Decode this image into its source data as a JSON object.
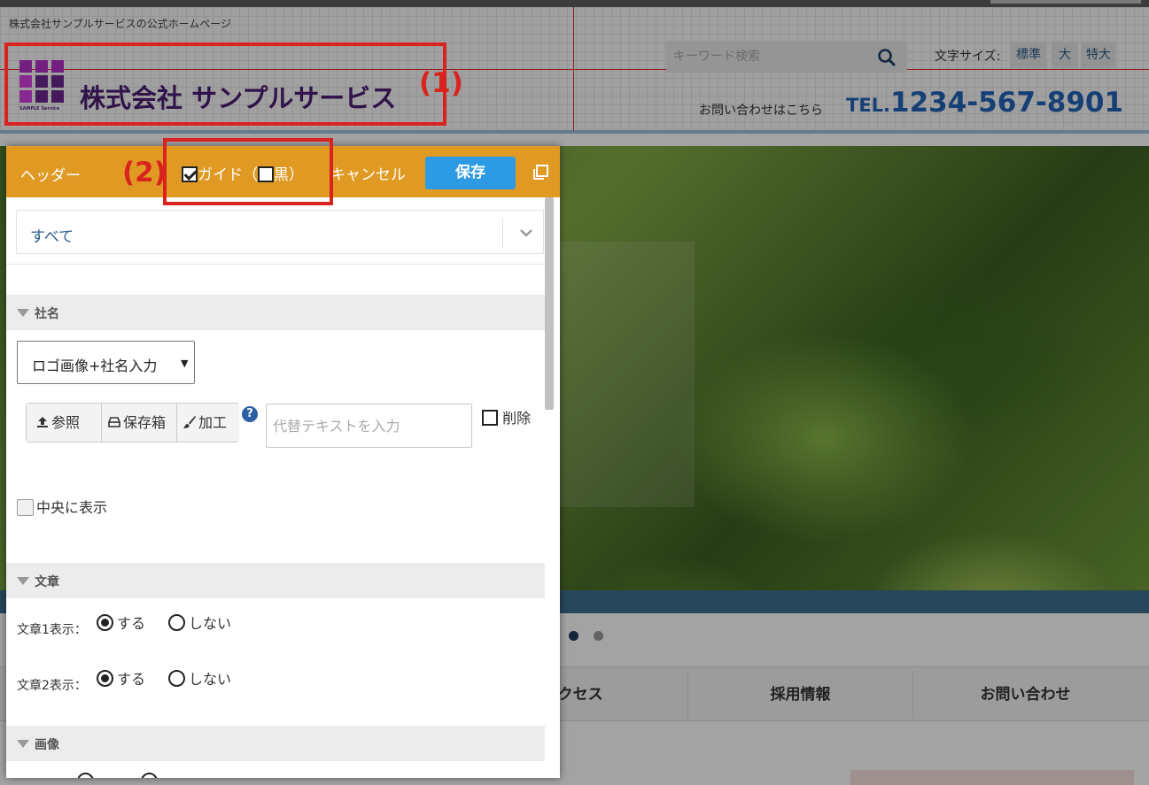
{
  "site": {
    "tagline": "株式会社サンプルサービスの公式ホームページ",
    "logo_sub": "SAMPLE Service",
    "company_name": "株式会社 サンプルサービス",
    "search_placeholder": "キーワード検索",
    "font_size_label": "文字サイズ:",
    "font_sizes": [
      "標準",
      "大",
      "特大"
    ],
    "contact_text": "お問い合わせはこちら",
    "tel_prefix": "TEL.",
    "tel_number": "1234-567-8901",
    "nav": [
      "アクセス",
      "採用情報",
      "お問い合わせ"
    ]
  },
  "annotations": [
    "(1)",
    "(2)"
  ],
  "panel": {
    "title": "ヘッダー",
    "guide_label": "ガイド（",
    "guide_checked": true,
    "black_label": "黒）",
    "black_checked": false,
    "cancel_label": "キャンセル",
    "save_label": "保存",
    "section_selector": "すべて",
    "sections": {
      "company": "社名",
      "text": "文章",
      "image": "画像"
    },
    "logo_mode": "ロゴ画像+社名入力",
    "buttons": {
      "browse": "参照",
      "storage": "保存箱",
      "edit": "加工"
    },
    "help": "?",
    "alt_placeholder": "代替テキストを入力",
    "delete_label": "削除",
    "center_label": "中央に表示",
    "text_rows": [
      {
        "label": "文章1表示：",
        "yes": "する",
        "no": "しない",
        "selected": "yes"
      },
      {
        "label": "文章2表示：",
        "yes": "する",
        "no": "しない",
        "selected": "yes"
      }
    ]
  },
  "colors": {
    "panel_header": "#e09a24",
    "save_button": "#2c9be3",
    "annotation": "#d9231f",
    "company_name": "#4b1f74",
    "tel": "#2365b8"
  }
}
